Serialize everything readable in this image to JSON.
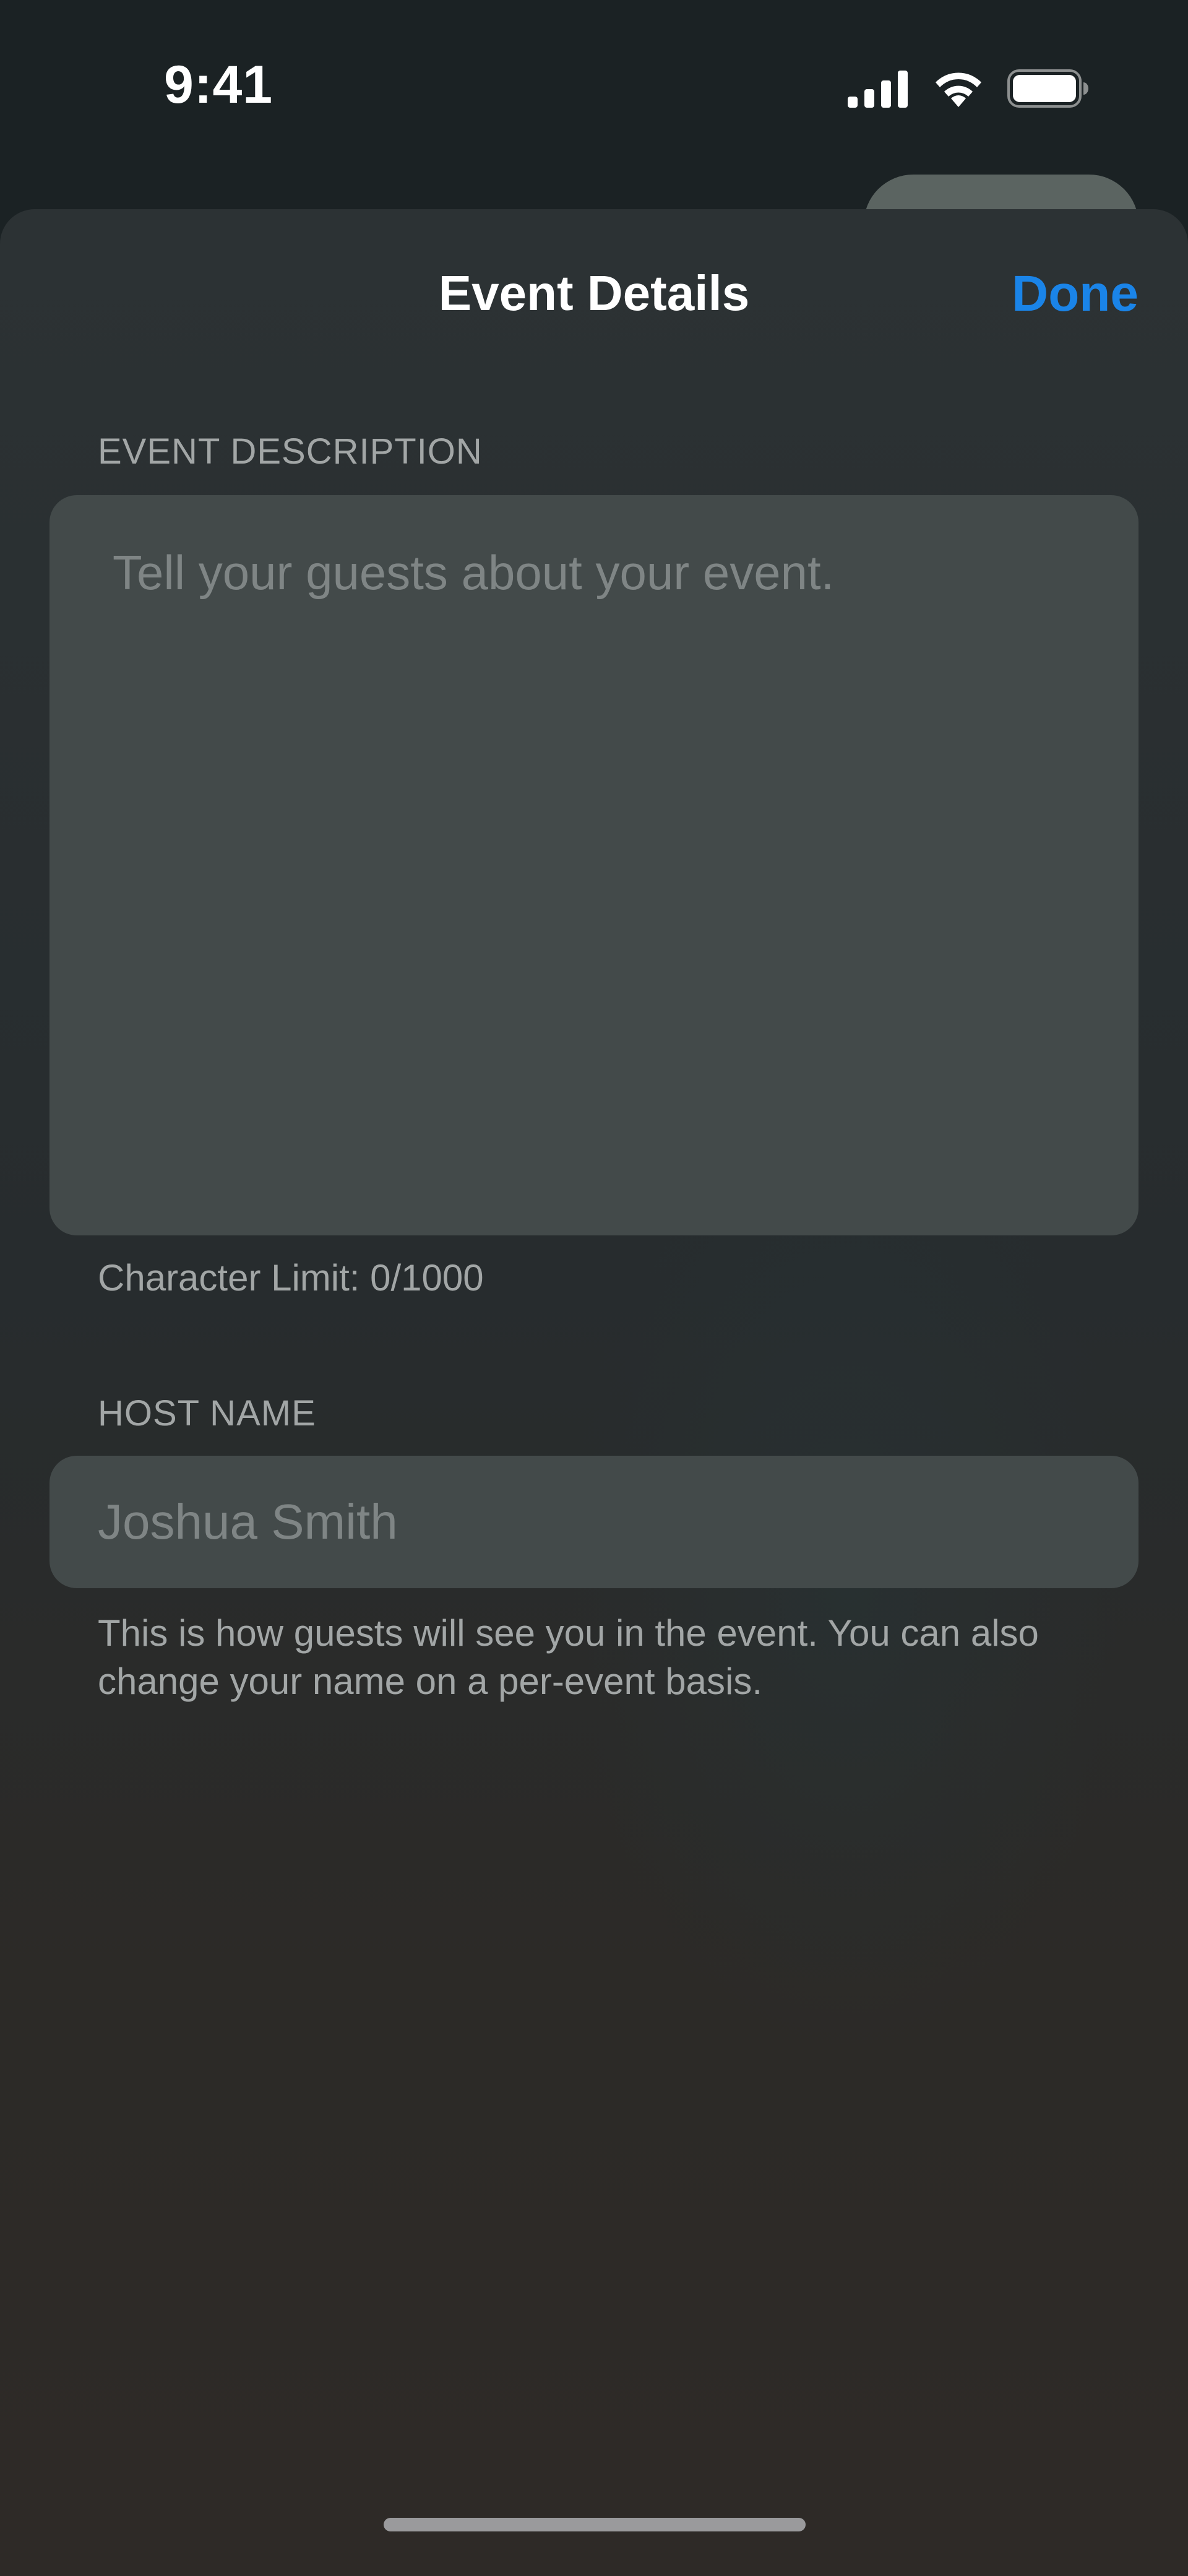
{
  "status_bar": {
    "time": "9:41",
    "icons": [
      "signal-icon",
      "wifi-icon",
      "battery-icon"
    ]
  },
  "sheet": {
    "title": "Event Details",
    "done_label": "Done"
  },
  "event_description": {
    "label": "EVENT DESCRIPTION",
    "placeholder": "Tell your guests about your event.",
    "value": "",
    "char_limit_text": "Character Limit: 0/1000"
  },
  "host_name": {
    "label": "HOST NAME",
    "placeholder": "Joshua Smith",
    "value": "",
    "help_text": "This is how guests will see you in the event. You can also change your name on a per-event basis."
  },
  "colors": {
    "accent": "#1a84e8",
    "sheet_background": "#2c3234",
    "field_background": "#434a4a",
    "secondary_text": "#a2a6a6"
  }
}
